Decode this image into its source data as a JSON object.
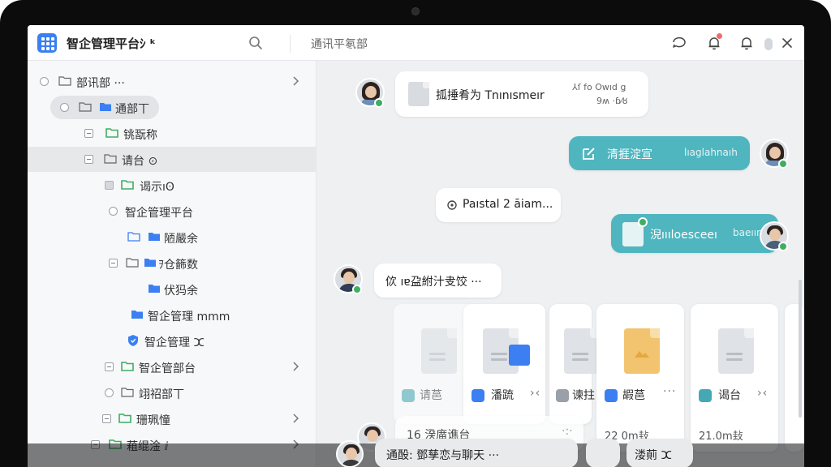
{
  "header": {
    "app_title": "智企管理平台ｼ ᵏ",
    "dept_label": "通讯平氡部"
  },
  "tree": [
    {
      "label": "部讯部 ···",
      "chevron": true
    },
    {
      "label": "通部丅"
    },
    {
      "label": "铫翫称"
    },
    {
      "label": "请台 ⊙"
    },
    {
      "label": "谒示ıʘ"
    },
    {
      "label": "智企管理平台"
    },
    {
      "label": "陋嚴余"
    },
    {
      "label": "ｦ仓籂数"
    },
    {
      "label": "伏犸余"
    },
    {
      "label": "智企管理 mmm"
    },
    {
      "label": "智企管理 ⵋ"
    },
    {
      "label": "智企管部台",
      "chevron": true
    },
    {
      "label": "翊祒部丅"
    },
    {
      "label": "珊珮憧",
      "chevron": true
    },
    {
      "label": "蒩绲淦 ⅈ",
      "chevron": true
    }
  ],
  "messages": {
    "m1_text": "㧓捶肴为 Tnınısmeır",
    "m1_meta_top": "⅄ſ fo Owıd​ ǥ",
    "m1_meta_bottom": "9ʍ ·ɓ⁄ȣ",
    "m2_text": "清捱淀宣",
    "m2_meta": "lıaglahnaıh",
    "m3_text": "Paıstal 2 āiam...",
    "m4_text": "淣ıııloesceeı",
    "m4_meta": "baeıınnın",
    "m5_text": "佽 ıɐ盁紨汁叏饺 ···",
    "m6_text": "16 湀庿谯台",
    "m7_text": "通酘: 鄧孳恋与聊天 ···",
    "m7_extra": "溇萴 ⵋ"
  },
  "files": [
    {
      "label": "请䓃"
    },
    {
      "label": "潘䟽"
    },
    {
      "label": "谏拄"
    },
    {
      "label": "嘏䓃",
      "size": "22 0m㪈"
    },
    {
      "label": "谒台",
      "size": "21.0m㪈"
    }
  ],
  "icons": {
    "search": "search-icon",
    "chat": "chat-icon",
    "bell": "bell-icon",
    "close": "close-icon"
  },
  "colors": {
    "accent": "#3b7ff2",
    "teal_bubble": "#4fb5bf",
    "folder_green": "#3fae62",
    "folder_blue": "#3b7ff2",
    "status_green": "#3fae62",
    "notification": "#f06a6a"
  }
}
